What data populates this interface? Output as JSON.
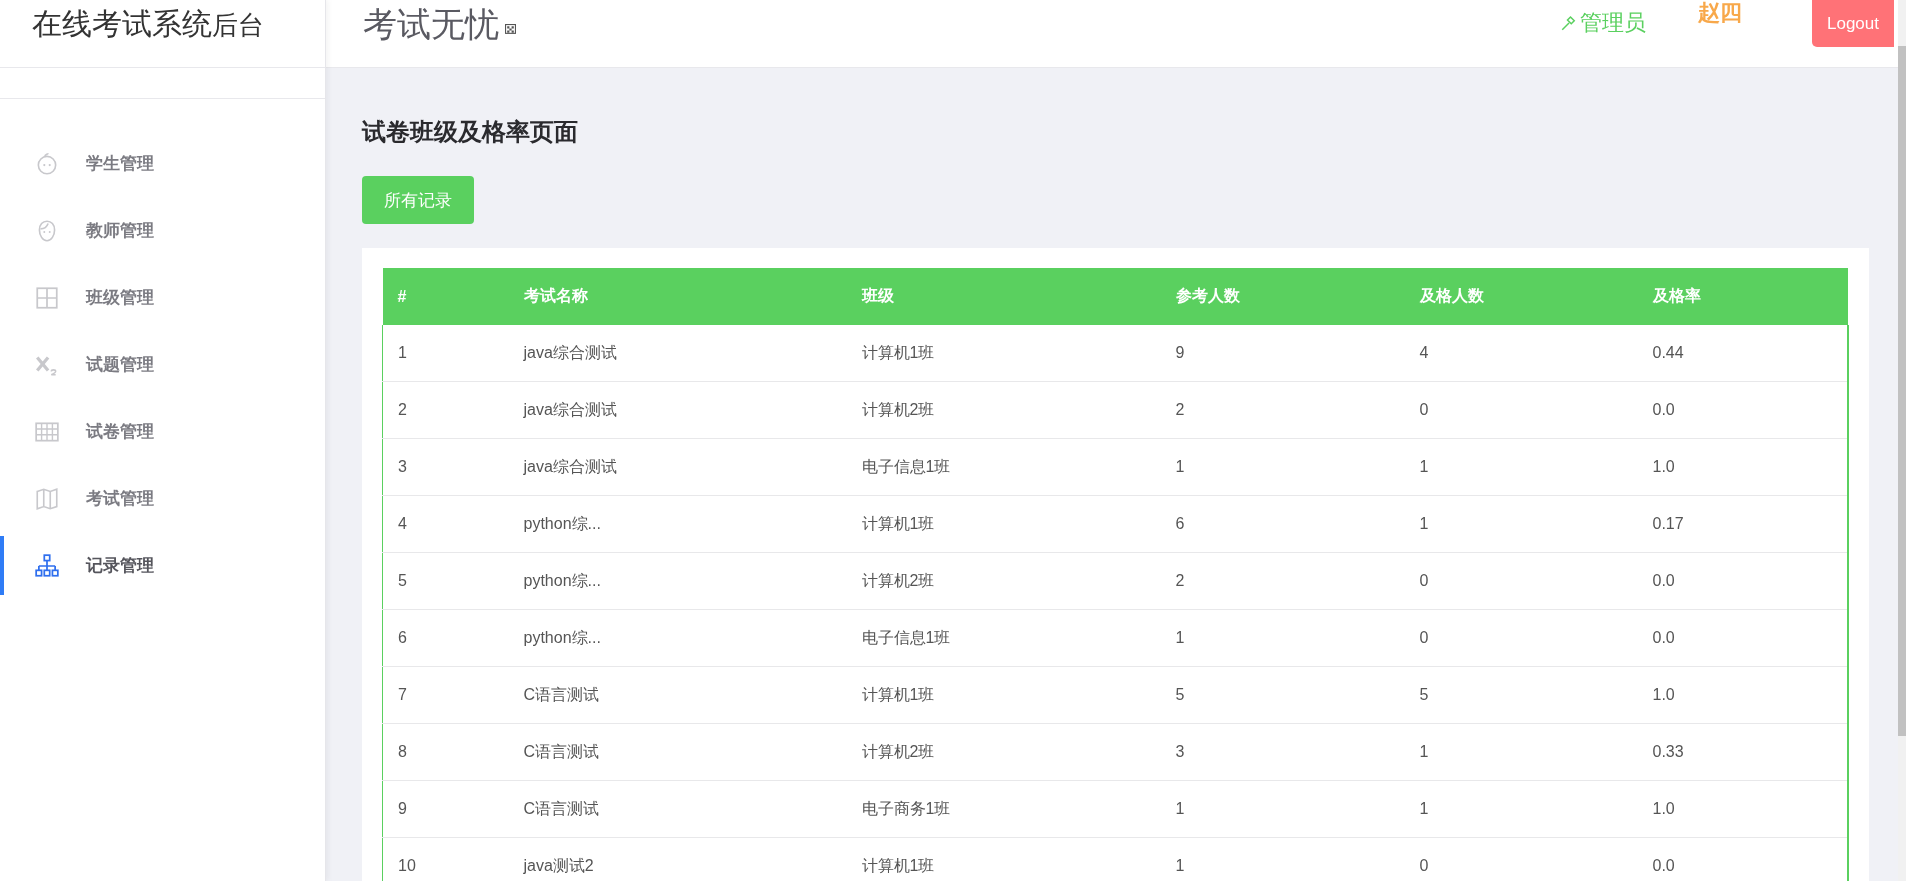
{
  "sidebar": {
    "title": "在线考试系统",
    "title_suffix": "后台",
    "items": [
      {
        "label": "学生管理",
        "selected": false
      },
      {
        "label": "教师管理",
        "selected": false
      },
      {
        "label": "班级管理",
        "selected": false
      },
      {
        "label": "试题管理",
        "selected": false
      },
      {
        "label": "试卷管理",
        "selected": false
      },
      {
        "label": "考试管理",
        "selected": false
      },
      {
        "label": "记录管理",
        "selected": true
      }
    ]
  },
  "header": {
    "title": "考试无忧",
    "role": "管理员",
    "user": "赵四",
    "logout": "Logout"
  },
  "page": {
    "title": "试卷班级及格率页面",
    "button": "所有记录"
  },
  "table": {
    "columns": [
      "#",
      "考试名称",
      "班级",
      "参考人数",
      "及格人数",
      "及格率"
    ],
    "rows": [
      [
        "1",
        "java综合测试",
        "计算机1班",
        "9",
        "4",
        "0.44"
      ],
      [
        "2",
        "java综合测试",
        "计算机2班",
        "2",
        "0",
        "0.0"
      ],
      [
        "3",
        "java综合测试",
        "电子信息1班",
        "1",
        "1",
        "1.0"
      ],
      [
        "4",
        "python综...",
        "计算机1班",
        "6",
        "1",
        "0.17"
      ],
      [
        "5",
        "python综...",
        "计算机2班",
        "2",
        "0",
        "0.0"
      ],
      [
        "6",
        "python综...",
        "电子信息1班",
        "1",
        "0",
        "0.0"
      ],
      [
        "7",
        "C语言测试",
        "计算机1班",
        "5",
        "5",
        "1.0"
      ],
      [
        "8",
        "C语言测试",
        "计算机2班",
        "3",
        "1",
        "0.33"
      ],
      [
        "9",
        "C语言测试",
        "电子商务1班",
        "1",
        "1",
        "1.0"
      ],
      [
        "10",
        "java测试2",
        "计算机1班",
        "1",
        "0",
        "0.0"
      ]
    ]
  }
}
